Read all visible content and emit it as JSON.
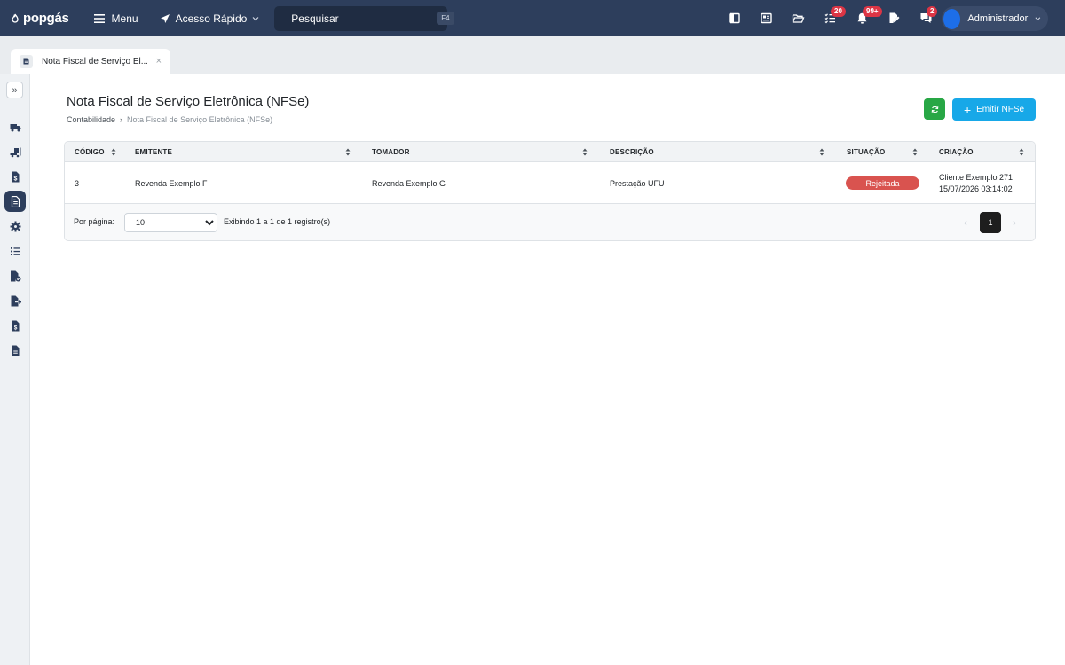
{
  "topbar": {
    "logo_text": "popgás",
    "menu_label": "Menu",
    "quick_access_label": "Acesso Rápido",
    "search_placeholder": "Pesquisar",
    "search_shortcut": "F4",
    "badges": {
      "tasks": "20",
      "notifications": "99+",
      "messages": "2"
    },
    "user_name": "Administrador"
  },
  "tab": {
    "label": "Nota Fiscal de Serviço El...",
    "close": "×"
  },
  "sidebar": {
    "toggle": "»",
    "icons": [
      "truck-icon",
      "truck-loading-icon",
      "dollar-file-icon",
      "invoice-file-icon",
      "gear-icon",
      "list-icon",
      "file-check-icon",
      "file-export-icon",
      "file-invoice-icon",
      "file-icon"
    ]
  },
  "page": {
    "title": "Nota Fiscal de Serviço Eletrônica (NFSe)",
    "breadcrumb": {
      "parent": "Contabilidade",
      "separator": "›",
      "current": "Nota Fiscal de Serviço Eletrônica (NFSe)"
    },
    "emit_button": "Emitir NFSe"
  },
  "table": {
    "headers": {
      "codigo": "CÓDIGO",
      "emitente": "EMITENTE",
      "tomador": "TOMADOR",
      "descricao": "DESCRIÇÃO",
      "situacao": "SITUAÇÃO",
      "criacao": "CRIAÇÃO"
    },
    "rows": [
      {
        "codigo": "3",
        "emitente": "Revenda Exemplo F",
        "tomador": "Revenda Exemplo G",
        "descricao": "Prestação UFU",
        "situacao": "Rejeitada",
        "criacao_user": "Cliente Exemplo 271",
        "criacao_date": "15/07/2026 03:14:02"
      }
    ]
  },
  "pagination": {
    "per_page_label": "Por página:",
    "per_page_value": "10",
    "showing": "Exibindo 1 a 1 de 1 registro(s)",
    "current_page": "1",
    "prev": "‹",
    "next": "›"
  },
  "colors": {
    "topbar": "#2d3e5c",
    "success": "#28a745",
    "primary": "#17a8e8",
    "danger": "#d9534f"
  }
}
